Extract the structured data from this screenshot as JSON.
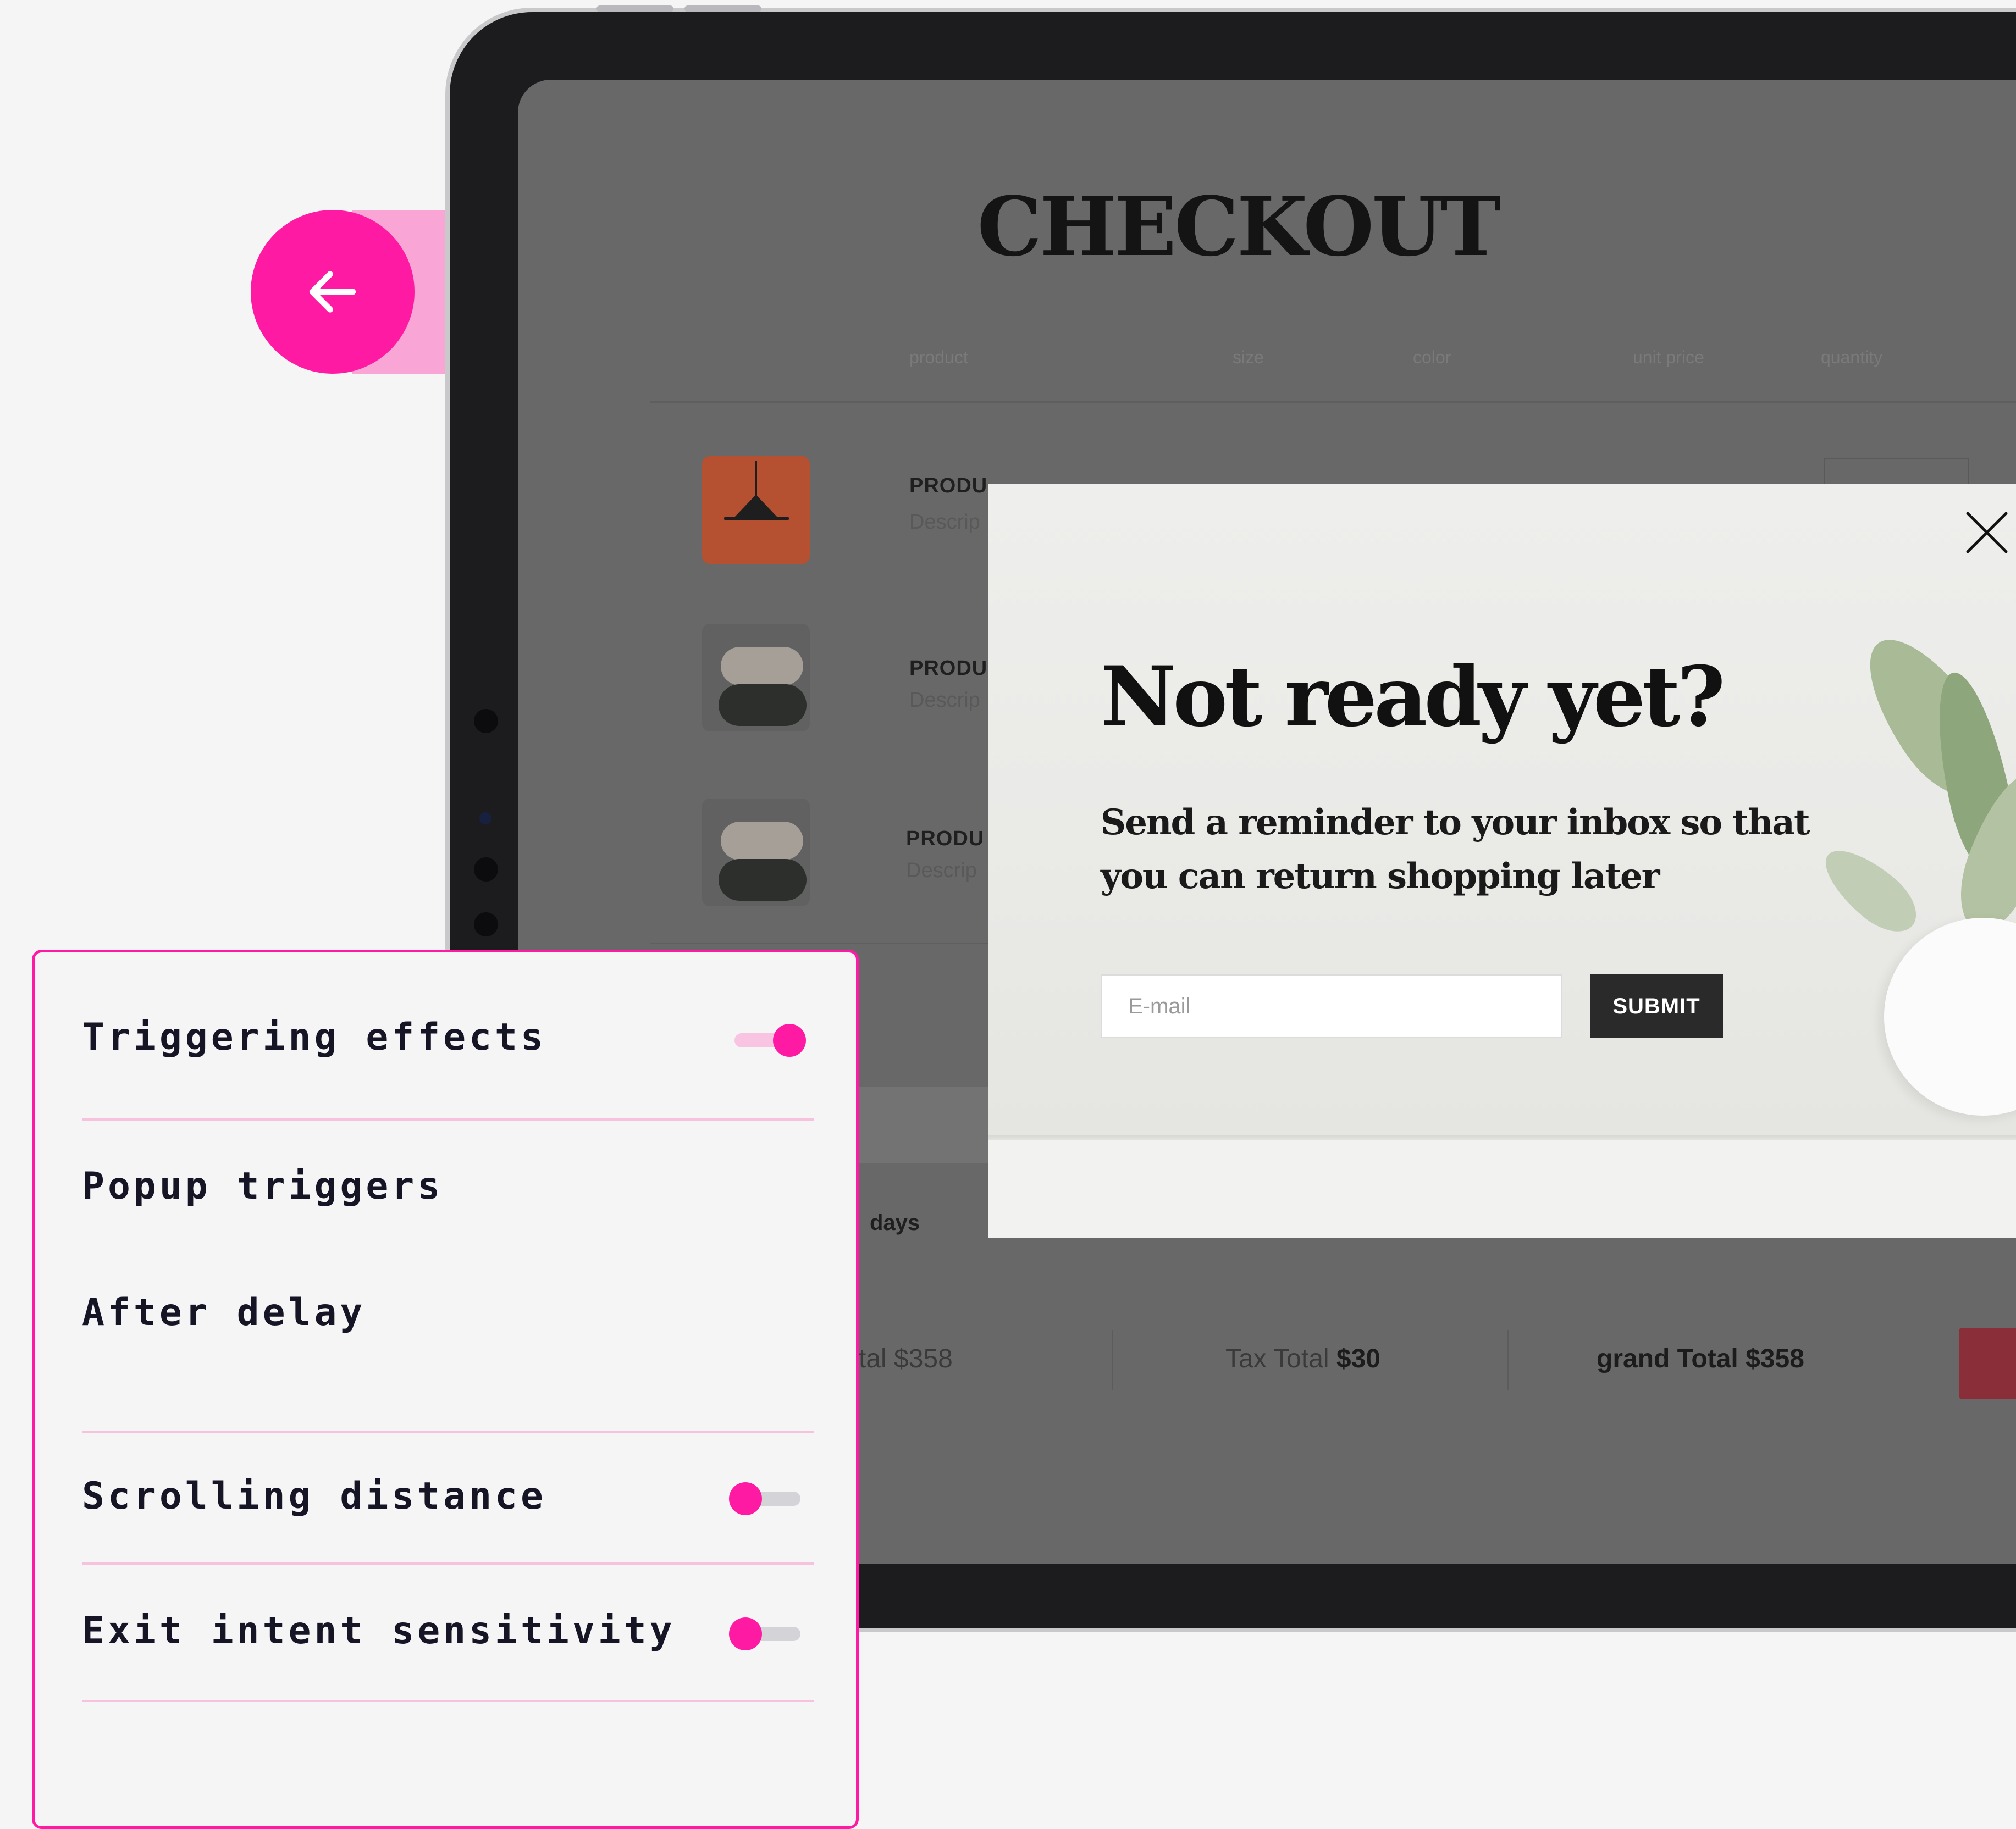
{
  "checkout": {
    "title": "CHECKOUT",
    "columns": [
      "product",
      "size",
      "color",
      "unit price",
      "quantity"
    ],
    "products": [
      {
        "name": "PRODU",
        "desc": "Descrip"
      },
      {
        "name": "PRODU",
        "desc": "Descrip"
      },
      {
        "name": "PRODU",
        "desc": "Descrip"
      }
    ],
    "delivery_fragment": "days",
    "totals": {
      "subtotal_fragment": "tal $358",
      "tax_label": "Tax Total",
      "tax_value": "$30",
      "grand_label": "grand Total",
      "grand_value": "$358"
    }
  },
  "popup": {
    "title": "Not ready yet?",
    "subtitle_line1": "Send a reminder to your inbox so that",
    "subtitle_line2": "you can return shopping later",
    "email_placeholder": "E-mail",
    "submit_label": "SUBMIT"
  },
  "settings": {
    "triggering_effects": {
      "label": "Triggering effects",
      "enabled": true
    },
    "popup_triggers_label": "Popup triggers",
    "after_delay_label": "After delay",
    "scrolling_distance": {
      "label": "Scrolling distance",
      "enabled": false
    },
    "exit_intent": {
      "label": "Exit intent sensitivity",
      "enabled": false
    }
  },
  "colors": {
    "accent": "#ff1aa3",
    "accent_light": "#f9c4e2",
    "panel_bg": "#f5f5f6"
  }
}
